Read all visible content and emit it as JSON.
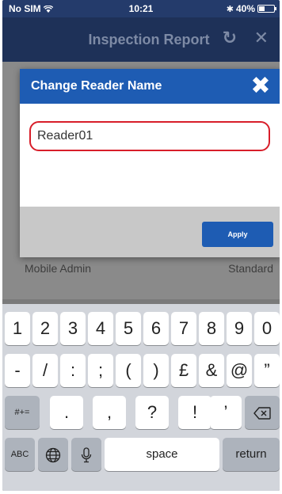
{
  "status_bar": {
    "carrier": "No SIM",
    "time": "10:21",
    "battery": "40%",
    "battery_level": 0.4
  },
  "header": {
    "title": "Inspection Report"
  },
  "background_row": {
    "left": "Mobile Admin",
    "right": "Standard"
  },
  "dialog": {
    "title": "Change Reader Name",
    "input_value": "Reader01",
    "apply_label": "Apply"
  },
  "keyboard": {
    "row1": [
      "1",
      "2",
      "3",
      "4",
      "5",
      "6",
      "7",
      "8",
      "9",
      "0"
    ],
    "row2": [
      "-",
      "/",
      ":",
      ";",
      "(",
      ")",
      "£",
      "&",
      "@",
      "”"
    ],
    "row3": {
      "shift": "#+=",
      "keys": [
        ".",
        ",",
        "?",
        "!",
        "’"
      ]
    },
    "row4": {
      "abc": "ABC",
      "space": "space",
      "return": "return"
    }
  }
}
